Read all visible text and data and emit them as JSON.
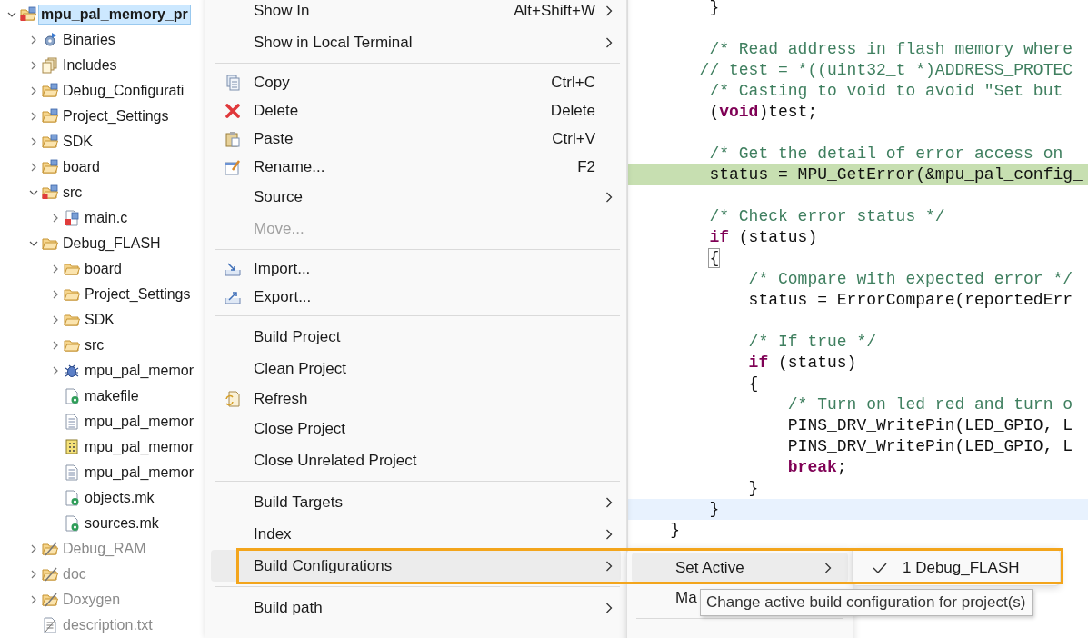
{
  "project_tree": [
    {
      "label": "mpu_pal_memory_pr",
      "kind": "project",
      "expanded": true,
      "selected": true,
      "dimmed": false,
      "children": [
        {
          "label": "Binaries",
          "kind": "binaries",
          "expanded": false,
          "selected": false,
          "dimmed": false
        },
        {
          "label": "Includes",
          "kind": "includes",
          "expanded": false,
          "selected": false,
          "dimmed": false
        },
        {
          "label": "Debug_Configurati",
          "kind": "source-folder",
          "expanded": false,
          "selected": false,
          "dimmed": false
        },
        {
          "label": "Project_Settings",
          "kind": "source-folder",
          "expanded": false,
          "selected": false,
          "dimmed": false
        },
        {
          "label": "SDK",
          "kind": "source-folder",
          "expanded": false,
          "selected": false,
          "dimmed": false
        },
        {
          "label": "board",
          "kind": "source-folder",
          "expanded": false,
          "selected": false,
          "dimmed": false
        },
        {
          "label": "src",
          "kind": "source-folder-error",
          "expanded": true,
          "selected": false,
          "dimmed": false,
          "children": [
            {
              "label": "main.c",
              "kind": "c-file-error",
              "expanded": false,
              "selected": false,
              "dimmed": false
            }
          ]
        },
        {
          "label": "Debug_FLASH",
          "kind": "folder",
          "expanded": true,
          "selected": false,
          "dimmed": false,
          "children": [
            {
              "label": "board",
              "kind": "folder",
              "expanded": false,
              "selected": false,
              "dimmed": false
            },
            {
              "label": "Project_Settings",
              "kind": "folder",
              "expanded": false,
              "selected": false,
              "dimmed": false
            },
            {
              "label": "SDK",
              "kind": "folder",
              "expanded": false,
              "selected": false,
              "dimmed": false
            },
            {
              "label": "src",
              "kind": "folder",
              "expanded": false,
              "selected": false,
              "dimmed": false
            },
            {
              "label": "mpu_pal_memor",
              "kind": "debug-binary",
              "expanded": false,
              "selected": false,
              "dimmed": false
            },
            {
              "label": "makefile",
              "kind": "make-file",
              "selected": false,
              "dimmed": false
            },
            {
              "label": "mpu_pal_memor",
              "kind": "text-file",
              "selected": false,
              "dimmed": false
            },
            {
              "label": "mpu_pal_memor",
              "kind": "binary-file",
              "selected": false,
              "dimmed": false
            },
            {
              "label": "mpu_pal_memor",
              "kind": "text-file",
              "selected": false,
              "dimmed": false
            },
            {
              "label": "objects.mk",
              "kind": "make-file",
              "selected": false,
              "dimmed": false
            },
            {
              "label": "sources.mk",
              "kind": "make-file",
              "selected": false,
              "dimmed": false
            }
          ]
        },
        {
          "label": "Debug_RAM",
          "kind": "excluded-folder",
          "expanded": false,
          "selected": false,
          "dimmed": true
        },
        {
          "label": "doc",
          "kind": "excluded-folder",
          "expanded": false,
          "selected": false,
          "dimmed": true
        },
        {
          "label": "Doxygen",
          "kind": "excluded-folder",
          "expanded": false,
          "selected": false,
          "dimmed": true
        },
        {
          "label": "description.txt",
          "kind": "excluded-file",
          "selected": false,
          "dimmed": true
        }
      ]
    }
  ],
  "context_menu": [
    {
      "kind": "item",
      "label": "Show In",
      "shortcut": "Alt+Shift+W",
      "submenu": true,
      "disabled": false,
      "selected": false
    },
    {
      "kind": "item",
      "label": "Show in Local Terminal",
      "submenu": true,
      "disabled": false,
      "selected": false
    },
    {
      "kind": "separator"
    },
    {
      "kind": "copy",
      "label": "Copy",
      "shortcut": "Ctrl+C",
      "submenu": false,
      "disabled": false,
      "selected": false
    },
    {
      "kind": "delete",
      "label": "Delete",
      "shortcut": "Delete",
      "submenu": false,
      "disabled": false,
      "selected": false
    },
    {
      "kind": "paste",
      "label": "Paste",
      "shortcut": "Ctrl+V",
      "submenu": false,
      "disabled": false,
      "selected": false
    },
    {
      "kind": "rename",
      "label": "Rename...",
      "shortcut": "F2",
      "submenu": false,
      "disabled": false,
      "selected": false
    },
    {
      "kind": "item",
      "label": "Source",
      "submenu": true,
      "disabled": false,
      "selected": false
    },
    {
      "kind": "item",
      "label": "Move...",
      "submenu": false,
      "disabled": true,
      "selected": false
    },
    {
      "kind": "separator"
    },
    {
      "kind": "import",
      "label": "Import...",
      "submenu": false,
      "disabled": false,
      "selected": false
    },
    {
      "kind": "export",
      "label": "Export...",
      "submenu": false,
      "disabled": false,
      "selected": false
    },
    {
      "kind": "separator"
    },
    {
      "kind": "item",
      "label": "Build Project",
      "submenu": false,
      "disabled": false,
      "selected": false
    },
    {
      "kind": "item",
      "label": "Clean Project",
      "submenu": false,
      "disabled": false,
      "selected": false
    },
    {
      "kind": "refresh",
      "label": "Refresh",
      "submenu": false,
      "disabled": false,
      "selected": false
    },
    {
      "kind": "item",
      "label": "Close Project",
      "submenu": false,
      "disabled": false,
      "selected": false
    },
    {
      "kind": "item",
      "label": "Close Unrelated Project",
      "submenu": false,
      "disabled": false,
      "selected": false
    },
    {
      "kind": "separator"
    },
    {
      "kind": "item",
      "label": "Build Targets",
      "submenu": true,
      "disabled": false,
      "selected": false
    },
    {
      "kind": "item",
      "label": "Index",
      "submenu": true,
      "disabled": false,
      "selected": false
    },
    {
      "kind": "item",
      "label": "Build Configurations",
      "submenu": true,
      "disabled": false,
      "selected": true
    },
    {
      "kind": "separator"
    },
    {
      "kind": "item",
      "label": "Build path",
      "submenu": true,
      "disabled": false,
      "selected": false
    }
  ],
  "build_configurations_menu": [
    {
      "label": "Set Active",
      "submenu": true,
      "selected": true
    },
    {
      "label": "Ma",
      "submenu": false,
      "selected": false
    }
  ],
  "set_active_menu": [
    {
      "label": "1 Debug_FLASH",
      "checked": true
    }
  ],
  "tooltip": "Change active build configuration for project(s)",
  "highlight_frame": true,
  "editor_lines": [
    {
      "kind": "code",
      "tokens": [
        {
          "text": "        }",
          "kind": "plain"
        }
      ]
    },
    {
      "kind": "blank"
    },
    {
      "kind": "code",
      "tokens": [
        {
          "text": "        /* Read address in flash memory where",
          "kind": "comment"
        }
      ]
    },
    {
      "kind": "code",
      "tokens": [
        {
          "text": "       // test = *((uint32_t *)ADDRESS_PROTEC",
          "kind": "comment"
        }
      ]
    },
    {
      "kind": "code",
      "tokens": [
        {
          "text": "        /* Casting to void to avoid \"Set but",
          "kind": "comment"
        }
      ]
    },
    {
      "kind": "code",
      "tokens": [
        {
          "text": "        (",
          "kind": "plain"
        },
        {
          "text": "void",
          "kind": "keyword"
        },
        {
          "text": ")test;",
          "kind": "plain"
        }
      ]
    },
    {
      "kind": "blank"
    },
    {
      "kind": "code",
      "tokens": [
        {
          "text": "        /* Get the detail of error access on",
          "kind": "comment"
        }
      ]
    },
    {
      "kind": "debug-line",
      "tokens": [
        {
          "text": "        status = MPU_GetError(&mpu_pal_config_",
          "kind": "plain"
        }
      ]
    },
    {
      "kind": "blank"
    },
    {
      "kind": "code",
      "tokens": [
        {
          "text": "        /* Check error status */",
          "kind": "comment"
        }
      ]
    },
    {
      "kind": "code",
      "tokens": [
        {
          "text": "        if",
          "kind": "keyword"
        },
        {
          "text": " (status)",
          "kind": "plain"
        }
      ]
    },
    {
      "kind": "code",
      "tokens": [
        {
          "text": "        {",
          "kind": "bracket-match"
        }
      ]
    },
    {
      "kind": "code",
      "tokens": [
        {
          "text": "            /* Compare with expected error */",
          "kind": "comment"
        }
      ]
    },
    {
      "kind": "code",
      "tokens": [
        {
          "text": "            status = ErrorCompare(reportedErr",
          "kind": "plain"
        }
      ]
    },
    {
      "kind": "blank"
    },
    {
      "kind": "code",
      "tokens": [
        {
          "text": "            /* If true */",
          "kind": "comment"
        }
      ]
    },
    {
      "kind": "code",
      "tokens": [
        {
          "text": "            if",
          "kind": "keyword"
        },
        {
          "text": " (status)",
          "kind": "plain"
        }
      ]
    },
    {
      "kind": "code",
      "tokens": [
        {
          "text": "            {",
          "kind": "plain"
        }
      ]
    },
    {
      "kind": "code",
      "tokens": [
        {
          "text": "                /* Turn on led red and turn o",
          "kind": "comment"
        }
      ]
    },
    {
      "kind": "code",
      "tokens": [
        {
          "text": "                PINS_DRV_WritePin(LED_GPIO, L",
          "kind": "plain"
        }
      ]
    },
    {
      "kind": "code",
      "tokens": [
        {
          "text": "                PINS_DRV_WritePin(LED_GPIO, L",
          "kind": "plain"
        }
      ]
    },
    {
      "kind": "code",
      "tokens": [
        {
          "text": "                break",
          "kind": "keyword"
        },
        {
          "text": ";",
          "kind": "plain"
        }
      ]
    },
    {
      "kind": "code",
      "tokens": [
        {
          "text": "            }",
          "kind": "plain"
        }
      ]
    },
    {
      "kind": "cursor-line",
      "tokens": [
        {
          "text": "        }",
          "kind": "plain"
        }
      ]
    },
    {
      "kind": "code",
      "tokens": [
        {
          "text": "    }",
          "kind": "plain"
        }
      ]
    }
  ]
}
